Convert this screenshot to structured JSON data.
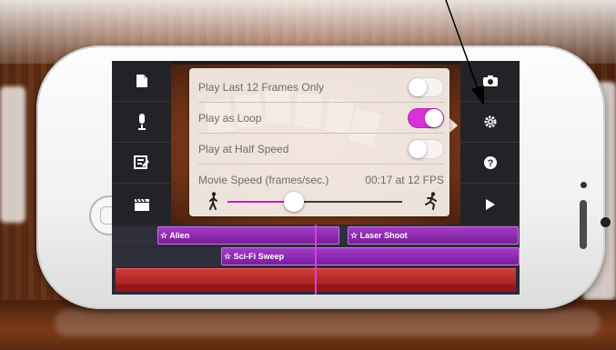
{
  "popover": {
    "rows": [
      {
        "label": "Play Last 12 Frames Only",
        "toggle_on": false
      },
      {
        "label": "Play as Loop",
        "toggle_on": true
      },
      {
        "label": "Play at Half Speed",
        "toggle_on": false
      }
    ],
    "speed_label": "Movie Speed (frames/sec.)",
    "speed_value": "00:17 at 12 FPS",
    "speed_fraction": 0.38
  },
  "timeline": {
    "clips": [
      {
        "label": "☆ Alien"
      },
      {
        "label": "☆ Laser Shoot"
      },
      {
        "label": "☆ Sci-Fi Sweep"
      }
    ]
  },
  "icons": {
    "left_toolbar": [
      "document-icon",
      "microphone-icon",
      "edit-frame-icon",
      "clapperboard-icon"
    ],
    "right_toolbar": [
      "camera-icon",
      "gear-icon",
      "help-icon",
      "play-icon"
    ],
    "slider": [
      "walking-person-icon",
      "running-person-icon"
    ]
  },
  "colors": {
    "accent": "#c21fc2",
    "clip": "#8a2bb2",
    "video_track": "#b82626"
  }
}
